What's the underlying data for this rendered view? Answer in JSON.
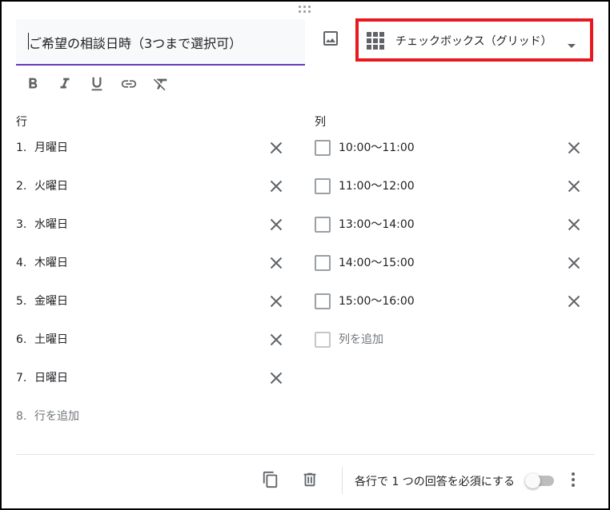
{
  "question": {
    "title": "ご希望の相談日時（3つまで選択可）",
    "type_label": "チェックボックス（グリッド）",
    "highlight_color": "#e8191e",
    "accent_color": "#673ab7"
  },
  "format_toolbar": {
    "icons": [
      "bold-icon",
      "italic-icon",
      "underline-icon",
      "link-icon",
      "clear-format-icon"
    ]
  },
  "rows": {
    "heading": "行",
    "items": [
      {
        "num": "1.",
        "label": "月曜日"
      },
      {
        "num": "2.",
        "label": "火曜日"
      },
      {
        "num": "3.",
        "label": "水曜日"
      },
      {
        "num": "4.",
        "label": "木曜日"
      },
      {
        "num": "5.",
        "label": "金曜日"
      },
      {
        "num": "6.",
        "label": "土曜日"
      },
      {
        "num": "7.",
        "label": "日曜日"
      }
    ],
    "add": {
      "num": "8.",
      "label": "行を追加"
    }
  },
  "columns": {
    "heading": "列",
    "items": [
      {
        "label": "10:00〜11:00"
      },
      {
        "label": "11:00〜12:00"
      },
      {
        "label": "13:00〜14:00"
      },
      {
        "label": "14:00〜15:00"
      },
      {
        "label": "15:00〜16:00"
      }
    ],
    "add": {
      "label": "列を追加"
    }
  },
  "footer": {
    "require_label": "各行で 1 つの回答を必須にする",
    "require_on": false
  }
}
